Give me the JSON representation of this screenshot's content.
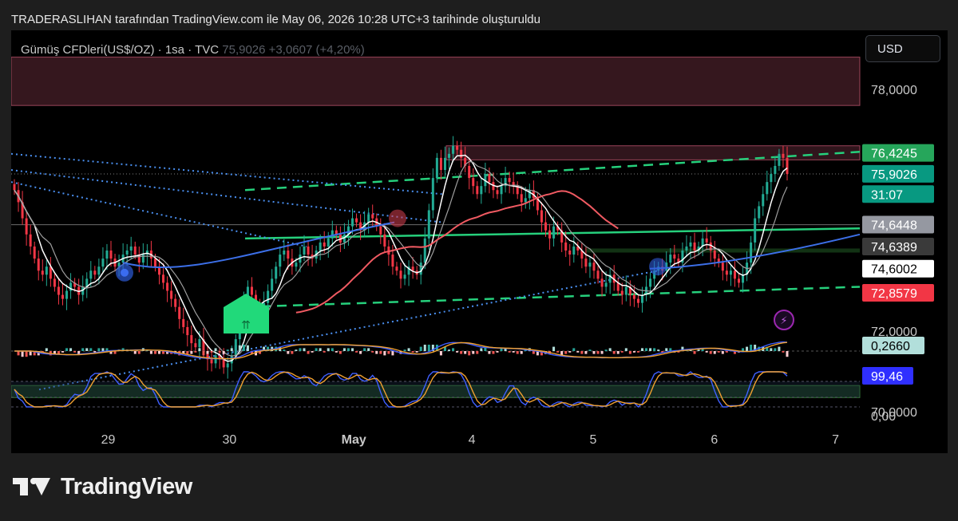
{
  "header": {
    "attribution": "TRADERASLIHAN tarafından TradingView.com ile May 06, 2026 10:28 UTC+3 tarihinde oluşturuldu"
  },
  "symbol": {
    "name": "Gümüş CFDleri(US$/OZ) · 1sa · TVC",
    "last": "75,9026",
    "change": "+3,0607 (+4,20%)"
  },
  "currency_button": "USD",
  "brand": "TradingView",
  "colors": {
    "up": "#22ab94",
    "down": "#f23645",
    "ma_fast": "#ffffff",
    "ma_slow": "#9e9e9e",
    "trend_green": "#26d07c",
    "trend_blue": "#4a8ff0",
    "ma_red": "#f05a62",
    "ma_blue": "#3c6fe8",
    "resistance_zone": "#f06a8a",
    "support_zone": "#2e7d32",
    "macd_signal": "#f0a030",
    "macd_line": "#3f5fff"
  },
  "icons": {
    "buy_marker": "double-arrow-up-icon",
    "event": "lightning-icon"
  },
  "chart_data": {
    "type": "candlestick",
    "x_tick_labels": [
      "29",
      "30",
      "May",
      "4",
      "5",
      "6",
      "7"
    ],
    "x_range": [
      0,
      7
    ],
    "x_ticks": [
      0.8,
      1.8,
      2.8,
      3.8,
      4.8,
      5.8,
      6.8
    ],
    "y_range": [
      69.7,
      79.2
    ],
    "y_tick_values": [
      78.0,
      72.0,
      70.0
    ],
    "y_tick_labels": [
      "78,0000",
      "72,0000",
      "70,0000"
    ],
    "price_labels": [
      {
        "text": "76,4245",
        "value": 76.4245,
        "color": "#26a65b",
        "text_color": "#ffffff"
      },
      {
        "text": "75,9026",
        "value": 75.9026,
        "color": "#089981",
        "text_color": "#ffffff"
      },
      {
        "text": "31:07",
        "value": 75.4,
        "color": "#089981",
        "text_color": "#ffffff"
      },
      {
        "text": "74,6448",
        "value": 74.6448,
        "color": "#9598a1",
        "text_color": "#ffffff"
      },
      {
        "text": "74,6389",
        "value": 74.1,
        "color": "#3a3a3a",
        "text_color": "#ffffff"
      },
      {
        "text": "74,6002",
        "value": 73.55,
        "color": "#ffffff",
        "text_color": "#000000"
      },
      {
        "text": "72,8579",
        "value": 72.95,
        "color": "#f23645",
        "text_color": "#ffffff"
      }
    ],
    "closes": [
      75.5,
      75.2,
      74.8,
      74.4,
      74.1,
      73.8,
      73.5,
      73.4,
      73.6,
      73.3,
      73.1,
      72.9,
      72.8,
      73.0,
      73.2,
      73.1,
      72.9,
      73.1,
      73.3,
      73.5,
      73.4,
      73.6,
      73.8,
      74.0,
      73.8,
      73.6,
      73.7,
      73.9,
      74.0,
      74.1,
      73.9,
      73.7,
      73.9,
      74.0,
      73.8,
      73.6,
      73.4,
      73.2,
      73.0,
      72.8,
      72.6,
      72.3,
      72.1,
      71.9,
      71.7,
      71.6,
      71.8,
      71.5,
      71.3,
      71.2,
      71.4,
      71.3,
      71.1,
      71.2,
      71.4,
      71.8,
      72.2,
      72.7,
      73.1,
      72.9,
      72.6,
      72.4,
      72.7,
      73.0,
      73.3,
      73.6,
      73.9,
      74.0,
      73.8,
      73.6,
      73.7,
      73.9,
      74.1,
      73.9,
      73.8,
      74.0,
      74.2,
      74.1,
      74.3,
      74.5,
      74.4,
      74.2,
      74.4,
      74.6,
      74.8,
      74.7,
      74.5,
      74.7,
      74.9,
      74.8,
      74.6,
      74.4,
      74.1,
      73.9,
      73.6,
      73.5,
      73.3,
      73.4,
      73.6,
      73.5,
      73.4,
      73.7,
      74.3,
      75.0,
      75.8,
      76.3,
      76.0,
      76.3,
      76.4,
      76.6,
      76.5,
      76.3,
      76.1,
      75.8,
      75.6,
      75.4,
      75.6,
      75.9,
      75.7,
      75.5,
      75.4,
      75.6,
      75.8,
      75.7,
      75.6,
      75.4,
      75.2,
      75.3,
      75.5,
      75.3,
      75.0,
      74.7,
      74.5,
      74.3,
      74.6,
      74.5,
      74.2,
      74.0,
      73.9,
      74.1,
      74.0,
      73.8,
      73.6,
      73.7,
      73.5,
      73.3,
      73.1,
      73.2,
      73.4,
      73.2,
      73.0,
      72.9,
      73.1,
      72.9,
      72.8,
      72.7,
      72.9,
      73.1,
      73.3,
      73.5,
      73.6,
      73.5,
      73.7,
      73.9,
      73.8,
      73.7,
      74.0,
      74.1,
      74.2,
      74.0,
      74.1,
      74.3,
      74.2,
      74.0,
      73.8,
      73.7,
      73.5,
      73.4,
      73.5,
      73.3,
      73.2,
      73.4,
      73.7,
      74.2,
      74.8,
      75.1,
      75.4,
      75.7,
      75.9,
      76.1,
      76.4,
      76.3,
      75.9
    ],
    "indicators": {
      "macd_value_label": "0,2660",
      "stoch_value_label": "99,46",
      "stoch_zero_label": "0,00"
    }
  }
}
